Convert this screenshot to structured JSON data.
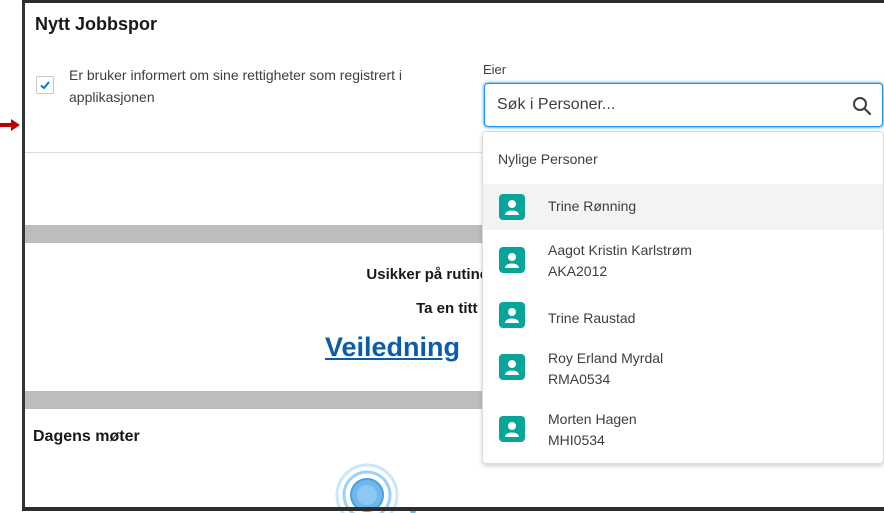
{
  "form": {
    "title": "Nytt Jobbspor",
    "consent_label": "Er bruker informert om sine rettigheter som registrert i applikasjonen",
    "consent_checked": true,
    "owner_label": "Eier",
    "search_placeholder": "Søk i Personer..."
  },
  "dropdown": {
    "heading": "Nylige Personer",
    "items": [
      {
        "name": "Trine Rønning",
        "sub": ""
      },
      {
        "name": "Aagot Kristin Karlstrøm",
        "sub": "AKA2012"
      },
      {
        "name": "Trine Raustad",
        "sub": ""
      },
      {
        "name": "Roy Erland Myrdal",
        "sub": "RMA0534"
      },
      {
        "name": "Morten Hagen",
        "sub": "MHI0534"
      }
    ]
  },
  "guide": {
    "line1": "Usikker på rutinen rundt opprett",
    "line2": "Ta en titt på veiled",
    "link": "Veiledning"
  },
  "meetings": {
    "title": "Dagens møter"
  },
  "colors": {
    "accent": "#0176d3",
    "link": "#0b5cab",
    "avatar": "#06a59a",
    "arrow": "#c00000"
  }
}
